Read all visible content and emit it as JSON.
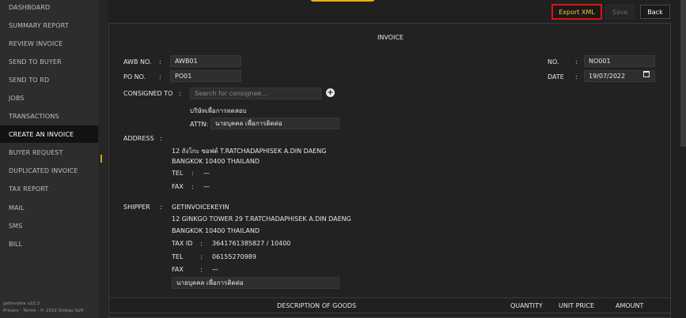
{
  "sidebar": {
    "items": [
      {
        "label": "DASHBOARD"
      },
      {
        "label": "SUMMARY REPORT"
      },
      {
        "label": "REVIEW INVOICE"
      },
      {
        "label": "SEND TO BUYER"
      },
      {
        "label": "SEND TO RD"
      },
      {
        "label": "JOBS"
      },
      {
        "label": "TRANSACTIONS"
      },
      {
        "label": "CREATE AN INVOICE",
        "active": true
      },
      {
        "label": "BUYER REQUEST"
      },
      {
        "label": "DUPLICATED INVOICE"
      },
      {
        "label": "TAX REPORT"
      },
      {
        "label": "MAIL"
      },
      {
        "label": "SMS"
      },
      {
        "label": "BILL"
      }
    ],
    "footer": {
      "version": "getInvoice v22.3",
      "privacy": "Privacy",
      "terms": "Terms",
      "copyright": "© 2022 Ginkgo Soft"
    }
  },
  "toolbar": {
    "export_label": "Export XML",
    "save_label": "Save",
    "back_label": "Back"
  },
  "invoice": {
    "title": "INVOICE",
    "awb_label": "AWB NO.",
    "awb_value": "AWB01",
    "po_label": "PO NO.",
    "po_value": "PO01",
    "no_label": "NO.",
    "no_value": "NO001",
    "date_label": "DATE",
    "date_value": "19/07/2022",
    "colon": ":",
    "consigned_label": "CONSIGNED TO",
    "consignee_placeholder": "Search for consignee...",
    "consignee_name": "บริษัทเพื่อการทดสอบ",
    "attn_label": "ATTN:",
    "attn_value": "นายบุคคล เพื่อการติดต่อ",
    "address_label": "ADDRESS",
    "address_line1": "12 ถังโกะ ซอฟต์ T.RATCHADAPHISEK A.DIN DAENG",
    "address_line2": "BANGKOK 10400 THAILAND",
    "tel_label": "TEL",
    "tel_value": "—",
    "fax_label": "FAX",
    "fax_value": "—",
    "shipper_label": "SHIPPER",
    "shipper_name": "GETINVOICEKEYIN",
    "shipper_line1": "12 GINKGO TOWER 29 T.RATCHADAPHISEK A.DIN DAENG",
    "shipper_line2": "BANGKOK 10400 THAILAND",
    "taxid_label": "TAX ID",
    "taxid_value": "3641761385827 / 10400",
    "shipper_tel_value": "06155270989",
    "shipper_fax_value": "—",
    "shipper_contact": "นายบุคคล เพื่อการติดต่อ"
  },
  "table": {
    "headers": [
      "DESCRIPTION OF GOODS",
      "QUANTITY",
      "UNIT PRICE",
      "AMOUNT"
    ]
  }
}
